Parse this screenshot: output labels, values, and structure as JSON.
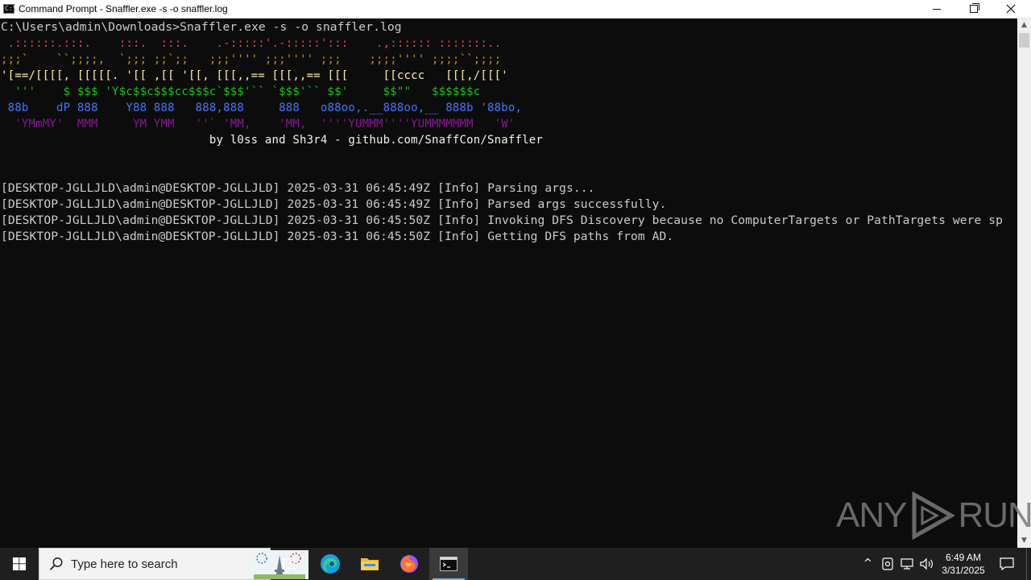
{
  "window": {
    "title": "Command Prompt - Snaffler.exe  -s -o snaffler.log"
  },
  "console": {
    "command_line": "C:\\Users\\admin\\Downloads>Snaffler.exe -s -o snaffler.log",
    "banner": [
      {
        "text": " .::::::.:::.    :::.  :::.    .-:::::'.-:::::':::    .,:::::: :::::::..",
        "color": "#e74856"
      },
      {
        "text": ";;;`    ``;;;;,  `;;; ;;`;;   ;;;'''' ;;;'''' ;;;    ;;;;'''' ;;;;``;;;;",
        "color": "#c19c00"
      },
      {
        "text": "'[==/[[[[, [[[[[. '[[ ,[[ '[[, [[[,,== [[[,,== [[[     [[cccc   [[[,/[[['",
        "color": "#f9f1a5"
      },
      {
        "text": "  '''    $ $$$ 'Y$c$$c$$$cc$$$c`$$$'`` `$$$'`` $$'     $$\"\"   $$$$$$c",
        "color": "#16c60c"
      },
      {
        "text": " 88b    dP 888    Y88 888   888,888     888   o88oo,.__888oo,__ 888b '88bo,",
        "color": "#3b78ff"
      },
      {
        "text": "  'YMmMY'  MMM     YM YMM   ''` 'MM,    'MM,  ''''YUMMM''''YUMMMMMMM   'W'",
        "color": "#881798"
      }
    ],
    "byline": "                              by l0ss and Sh3r4 - github.com/SnaffCon/Snaffler",
    "log_lines": [
      "[DESKTOP-JGLLJLD\\admin@DESKTOP-JGLLJLD] 2025-03-31 06:45:49Z [Info] Parsing args...",
      "[DESKTOP-JGLLJLD\\admin@DESKTOP-JGLLJLD] 2025-03-31 06:45:49Z [Info] Parsed args successfully.",
      "[DESKTOP-JGLLJLD\\admin@DESKTOP-JGLLJLD] 2025-03-31 06:45:50Z [Info] Invoking DFS Discovery because no ComputerTargets or PathTargets were sp",
      "[DESKTOP-JGLLJLD\\admin@DESKTOP-JGLLJLD] 2025-03-31 06:45:50Z [Info] Getting DFS paths from AD."
    ]
  },
  "watermark": {
    "left": "ANY",
    "right": "RUN"
  },
  "taskbar": {
    "search_placeholder": "Type here to search",
    "apps": [
      "task-view",
      "edge",
      "file-explorer",
      "firefox",
      "command-prompt"
    ],
    "clock_time": "6:49 AM",
    "clock_date": "3/31/2025"
  },
  "colors": {
    "console_bg": "#0c0c0c",
    "console_text": "#cccccc",
    "taskbar_bg": "#1f1f1f",
    "accent": "#76b9ed"
  }
}
